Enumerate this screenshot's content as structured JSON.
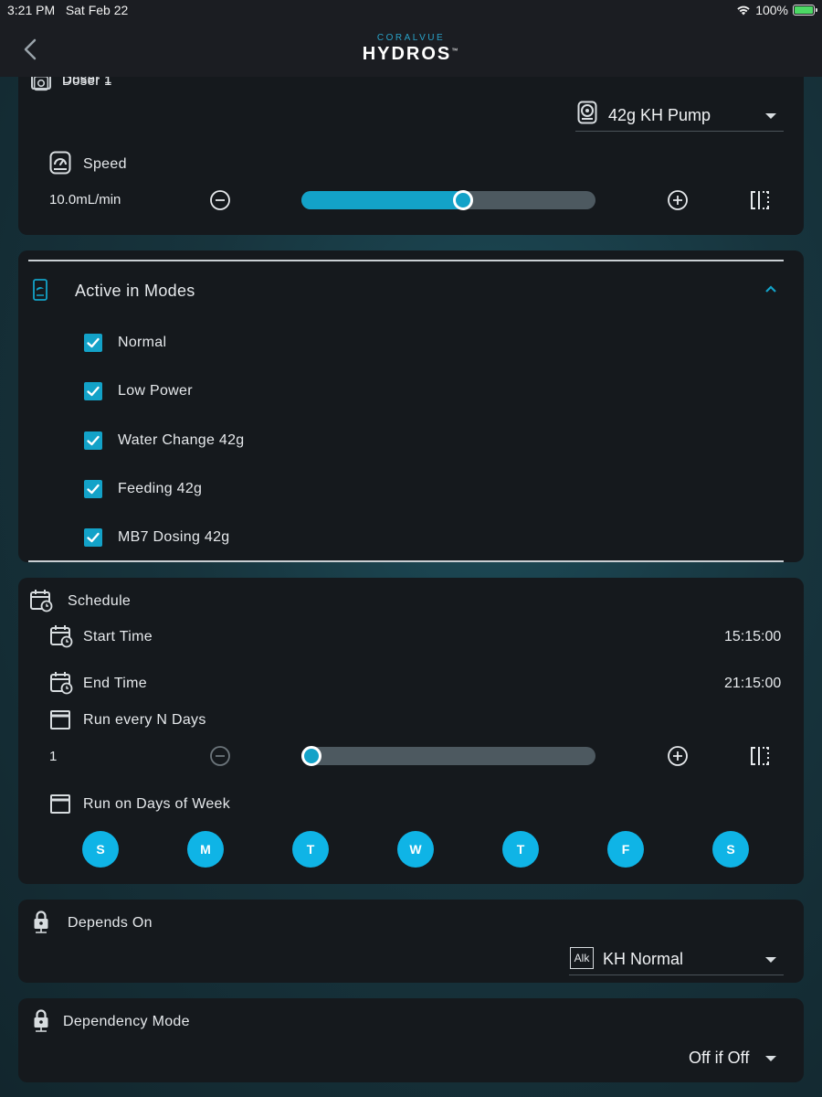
{
  "status_bar": {
    "time": "3:21 PM",
    "date": "Sat Feb 22",
    "battery": "100%",
    "battery_level": 1.0,
    "icons": [
      "wifi-icon",
      "battery-charging-icon"
    ]
  },
  "nav": {
    "back_icon": "chevron-left-icon",
    "logo_top": "CORALVUE",
    "logo_main": "HYDROS",
    "logo_tm": "™"
  },
  "doser_card": {
    "title": "Doser 1",
    "pump_select": {
      "value": "42g KH Pump",
      "icon": "pump-icon"
    },
    "speed": {
      "label": "Speed",
      "icon": "gauge-icon",
      "value": "10.0mL/min",
      "level": 0.55,
      "minus_icon": "minus-circle-icon",
      "plus_icon": "plus-circle-icon",
      "split_icon": "split-view-icon"
    }
  },
  "modes_card": {
    "title": "Active in Modes",
    "icon": "mode-phone-icon",
    "collapse_icon": "chevron-up-icon",
    "modes": [
      {
        "label": "Normal",
        "checked": true
      },
      {
        "label": "Low Power",
        "checked": true
      },
      {
        "label": "Water Change 42g",
        "checked": true
      },
      {
        "label": "Feeding 42g",
        "checked": true
      },
      {
        "label": "MB7 Dosing 42g",
        "checked": true
      }
    ]
  },
  "schedule_card": {
    "title": "Schedule",
    "icon": "calendar-clock-icon",
    "start_time": {
      "label": "Start Time",
      "value": "15:15:00"
    },
    "end_time": {
      "label": "End Time",
      "value": "21:15:00"
    },
    "run_every": {
      "label": "Run every N Days",
      "value": "1",
      "level": 0.0
    },
    "days_label": "Run on Days of Week",
    "days": [
      "S",
      "M",
      "T",
      "W",
      "T",
      "F",
      "S"
    ]
  },
  "depends_card": {
    "title": "Depends On",
    "icon": "lock-icon",
    "select": {
      "badge": "Alk",
      "value": "KH Normal"
    }
  },
  "dependency_mode_card": {
    "title": "Dependency Mode",
    "icon": "lock-icon",
    "select": {
      "value": "Off if Off"
    }
  },
  "colors": {
    "accent": "#13a2c8",
    "day_circle": "#0fb4e6",
    "card_bg": "#15191d",
    "bar_bg": "#1b1d22"
  }
}
